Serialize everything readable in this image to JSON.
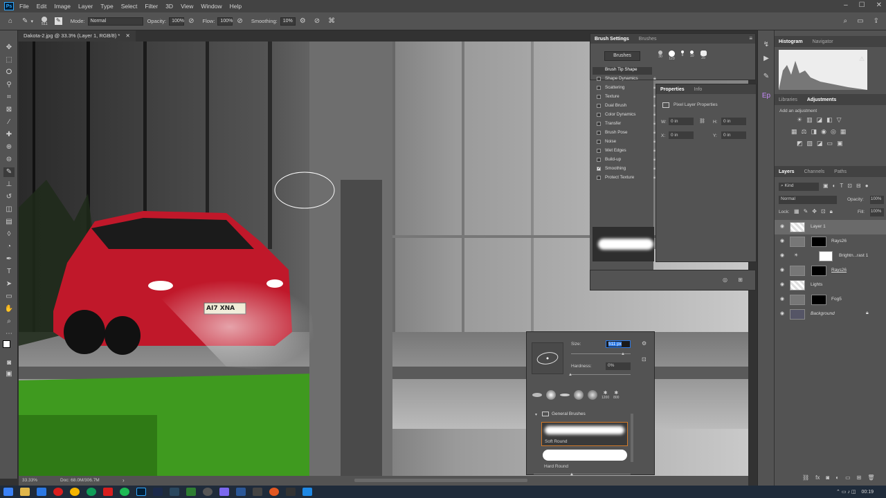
{
  "app": {
    "menu": [
      "File",
      "Edit",
      "Image",
      "Layer",
      "Type",
      "Select",
      "Filter",
      "3D",
      "View",
      "Window",
      "Help"
    ]
  },
  "options": {
    "brush_size": "511",
    "mode_label": "Mode:",
    "mode_value": "Normal",
    "opacity_label": "Opacity:",
    "opacity_value": "100%",
    "flow_label": "Flow:",
    "flow_value": "100%",
    "smoothing_label": "Smoothing:",
    "smoothing_value": "10%"
  },
  "document": {
    "tab": "Dakota-2.jpg @ 33.3% (Layer 1, RGB/8) *",
    "zoom": "33.33%",
    "doc_size": "Doc: 68.0M/306.7M",
    "plate": "AI7 XNA"
  },
  "brush_settings": {
    "tabs": [
      "Brush Settings",
      "Brushes"
    ],
    "brushes_button": "Brushes",
    "items": [
      "Brush Tip Shape",
      "Shape Dynamics",
      "Scattering",
      "Texture",
      "Dual Brush",
      "Color Dynamics",
      "Transfer",
      "Brush Pose",
      "Noise",
      "Wet Edges",
      "Build-up",
      "Smoothing",
      "Protect Texture"
    ],
    "checked": [
      "Smoothing"
    ],
    "tip_sizes": [
      "30",
      "123",
      "8",
      "10",
      "25"
    ]
  },
  "properties": {
    "tabs": [
      "Properties",
      "Info"
    ],
    "title": "Pixel Layer Properties",
    "w_label": "W:",
    "w_value": "0 in",
    "h_label": "H:",
    "h_value": "0 in",
    "x_label": "X:",
    "x_value": "0 in",
    "y_label": "Y:",
    "y_value": "0 in"
  },
  "histogram": {
    "tabs": [
      "Histogram",
      "Navigator"
    ]
  },
  "adjustments": {
    "tabs": [
      "Libraries",
      "Adjustments"
    ],
    "add_label": "Add an adjustment"
  },
  "layers_panel": {
    "tabs": [
      "Layers",
      "Channels",
      "Paths"
    ],
    "kind": "Kind",
    "blend": "Normal",
    "opacity_label": "Opacity:",
    "opacity_value": "100%",
    "lock_label": "Lock:",
    "fill_label": "Fill:",
    "fill_value": "100%",
    "layers": [
      "Layer 1",
      "Rays26",
      "Brightn...rast 1",
      "Rays26",
      "Lights",
      "Fog5",
      "Background"
    ]
  },
  "picker": {
    "size_label": "Size:",
    "size_value": "511 px",
    "hardness_label": "Hardness:",
    "hardness_value": "0%",
    "preset_sizes": [
      "1200",
      "800"
    ],
    "folder": "General Brushes",
    "brushes": [
      "Soft Round",
      "Hard Round"
    ]
  },
  "taskbar": {
    "time": "00:19"
  },
  "colors": {
    "ps_bg": "#535353",
    "accent": "#31a8ff",
    "car": "#c0182a"
  }
}
